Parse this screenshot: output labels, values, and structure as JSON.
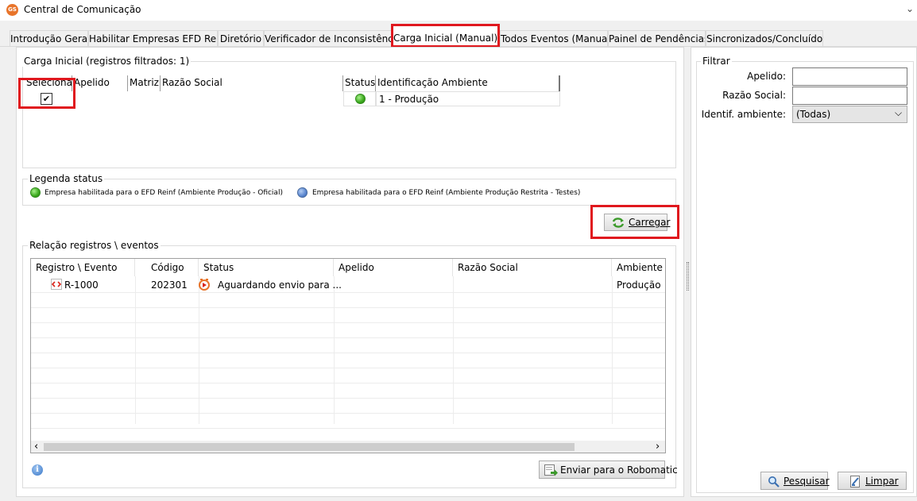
{
  "window": {
    "icon_text": "GS",
    "title": "Central de Comunicação",
    "chevron": "⌄"
  },
  "tabs": [
    {
      "label": "Introdução Geral"
    },
    {
      "label": "Habilitar Empresas EFD Reinf"
    },
    {
      "label": "Diretório"
    },
    {
      "label": "Verificador de Inconsistências"
    },
    {
      "label": "Carga Inicial (Manual)",
      "active": true
    },
    {
      "label": "Todos Eventos (Manual)"
    },
    {
      "label": "Painel de Pendências"
    },
    {
      "label": "Sincronizados/Concluídos"
    }
  ],
  "carga": {
    "group_title": "Carga Inicial (registros filtrados: 1)",
    "columns": [
      "Selecionar",
      "Apelido",
      "Matriz",
      "Razão Social",
      "Status",
      "Identificação Ambiente"
    ],
    "rows": [
      {
        "checked": true,
        "check_glyph": "✔",
        "apelido": "",
        "matriz": "",
        "razao": "",
        "status_color": "green",
        "ambiente": "1 - Produção"
      }
    ]
  },
  "legend": {
    "title": "Legenda status",
    "items": [
      {
        "color": "green",
        "text": "Empresa habilitada para o EFD Reinf (Ambiente Produção - Oficial)"
      },
      {
        "color": "blue",
        "text": "Empresa habilitada para o EFD Reinf (Ambiente Produção Restrita - Testes)"
      }
    ]
  },
  "carregar_button": {
    "label": "Carregar",
    "icon": "refresh-icon"
  },
  "relacao": {
    "group_title": "Relação registros \\ eventos",
    "columns": [
      "Registro \\ Evento",
      "Código",
      "Status",
      "Apelido",
      "Razão Social",
      "Ambiente"
    ],
    "rows": [
      {
        "evento": "R-1000",
        "codigo": "202301",
        "status": "Aguardando envio para ...",
        "apelido": "",
        "razao": "",
        "ambiente": "Produção"
      }
    ],
    "scroll_left": "‹",
    "scroll_right": "›"
  },
  "info_icon": "i",
  "enviar_button": {
    "label": "Enviar para o Robomatic",
    "icon": "send-icon"
  },
  "filter": {
    "title": "Filtrar",
    "apelido_label": "Apelido:",
    "apelido_value": "",
    "razao_label": "Razão Social:",
    "razao_value": "",
    "ambiente_label": "Identif. ambiente:",
    "ambiente_value": "(Todas)",
    "select_arrow": "⌵"
  },
  "pesquisar_button": {
    "label": "Pesquisar",
    "icon": "search-icon"
  },
  "limpar_button": {
    "label": "Limpar",
    "icon": "clear-icon"
  },
  "colors": {
    "highlight": "#e0181e",
    "status_green": "#3aa81c",
    "status_blue": "#5a86cf",
    "event_icon": "#d9251c",
    "status_icon": "#e8742a"
  }
}
